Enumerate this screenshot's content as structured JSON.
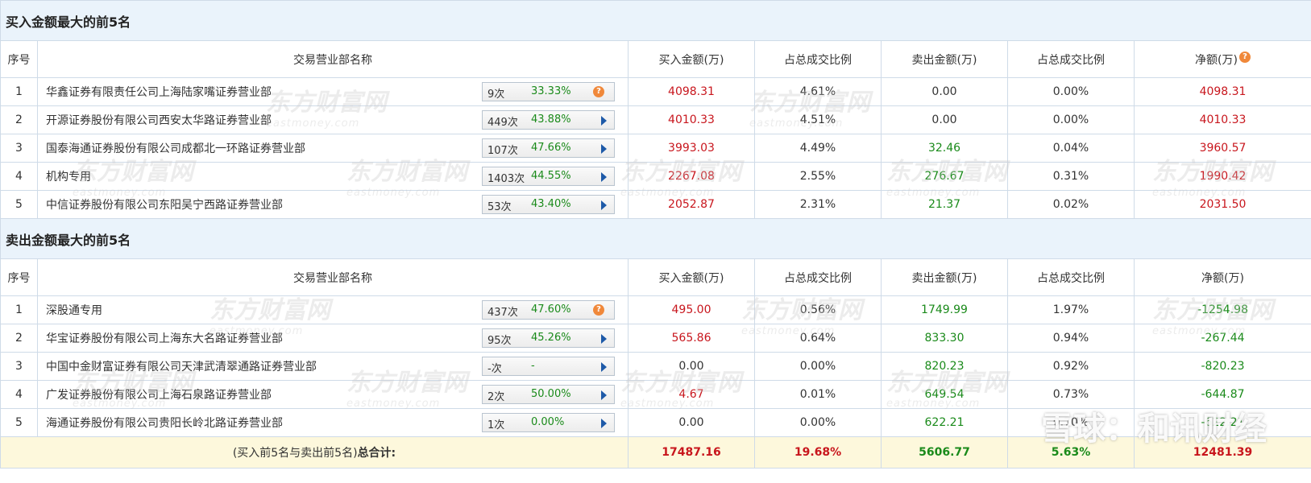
{
  "buy_section": {
    "title": "买入金额最大的前5名",
    "headers": [
      "序号",
      "交易营业部名称",
      "买入金额(万)",
      "占总成交比例",
      "卖出金额(万)",
      "占总成交比例",
      "净额(万)"
    ],
    "header_help_icon": "question-icon",
    "rows": [
      {
        "seq": "1",
        "name": "华鑫证券有限责任公司上海陆家嘴证券营业部",
        "count": "9次",
        "rate": "33.33%",
        "marker": "question",
        "buy": "4098.31",
        "buy_pct": "4.61%",
        "sell": "0.00",
        "sell_pct": "0.00%",
        "net": "4098.31"
      },
      {
        "seq": "2",
        "name": "开源证券股份有限公司西安太华路证券营业部",
        "count": "449次",
        "rate": "43.88%",
        "marker": "arrow",
        "buy": "4010.33",
        "buy_pct": "4.51%",
        "sell": "0.00",
        "sell_pct": "0.00%",
        "net": "4010.33"
      },
      {
        "seq": "3",
        "name": "国泰海通证券股份有限公司成都北一环路证券营业部",
        "count": "107次",
        "rate": "47.66%",
        "marker": "arrow",
        "buy": "3993.03",
        "buy_pct": "4.49%",
        "sell": "32.46",
        "sell_pct": "0.04%",
        "net": "3960.57"
      },
      {
        "seq": "4",
        "name": "机构专用",
        "count": "1403次",
        "rate": "44.55%",
        "marker": "arrow",
        "buy": "2267.08",
        "buy_pct": "2.55%",
        "sell": "276.67",
        "sell_pct": "0.31%",
        "net": "1990.42"
      },
      {
        "seq": "5",
        "name": "中信证券股份有限公司东阳吴宁西路证券营业部",
        "count": "53次",
        "rate": "43.40%",
        "marker": "arrow",
        "buy": "2052.87",
        "buy_pct": "2.31%",
        "sell": "21.37",
        "sell_pct": "0.02%",
        "net": "2031.50"
      }
    ]
  },
  "sell_section": {
    "title": "卖出金额最大的前5名",
    "headers": [
      "序号",
      "交易营业部名称",
      "买入金额(万)",
      "占总成交比例",
      "卖出金额(万)",
      "占总成交比例",
      "净额(万)"
    ],
    "rows": [
      {
        "seq": "1",
        "name": "深股通专用",
        "count": "437次",
        "rate": "47.60%",
        "marker": "question",
        "buy": "495.00",
        "buy_pct": "0.56%",
        "sell": "1749.99",
        "sell_pct": "1.97%",
        "net": "-1254.98"
      },
      {
        "seq": "2",
        "name": "华宝证券股份有限公司上海东大名路证券营业部",
        "count": "95次",
        "rate": "45.26%",
        "marker": "arrow",
        "buy": "565.86",
        "buy_pct": "0.64%",
        "sell": "833.30",
        "sell_pct": "0.94%",
        "net": "-267.44"
      },
      {
        "seq": "3",
        "name": "中国中金财富证券有限公司天津武清翠通路证券营业部",
        "count": "-次",
        "rate": "-",
        "marker": "arrow",
        "buy": "0.00",
        "buy_pct": "0.00%",
        "sell": "820.23",
        "sell_pct": "0.92%",
        "net": "-820.23"
      },
      {
        "seq": "4",
        "name": "广发证券股份有限公司上海石泉路证券营业部",
        "count": "2次",
        "rate": "50.00%",
        "marker": "arrow",
        "buy": "4.67",
        "buy_pct": "0.01%",
        "sell": "649.54",
        "sell_pct": "0.73%",
        "net": "-644.87"
      },
      {
        "seq": "5",
        "name": "海通证券股份有限公司贵阳长岭北路证券营业部",
        "count": "1次",
        "rate": "0.00%",
        "marker": "arrow",
        "buy": "0.00",
        "buy_pct": "0.00%",
        "sell": "622.21",
        "sell_pct": "0.70%",
        "net": "-622.21"
      }
    ]
  },
  "total": {
    "label_prefix": "(买入前5名与卖出前5名)",
    "label_bold": "总合计:",
    "buy": "17487.16",
    "buy_pct": "19.68%",
    "sell": "5606.77",
    "sell_pct": "5.63%",
    "net": "12481.39"
  },
  "watermark": {
    "cn": "东方财富网",
    "en": "eastmoney.com"
  },
  "overlay_mark": "雪球：和讯财经",
  "colors": {
    "positive": "#c8161d",
    "negative": "#1a8a1a",
    "section_bg": "#eaf3fb",
    "total_bg": "#fdf8dc",
    "arrow": "#1e5aa8",
    "help": "#f0883a"
  }
}
